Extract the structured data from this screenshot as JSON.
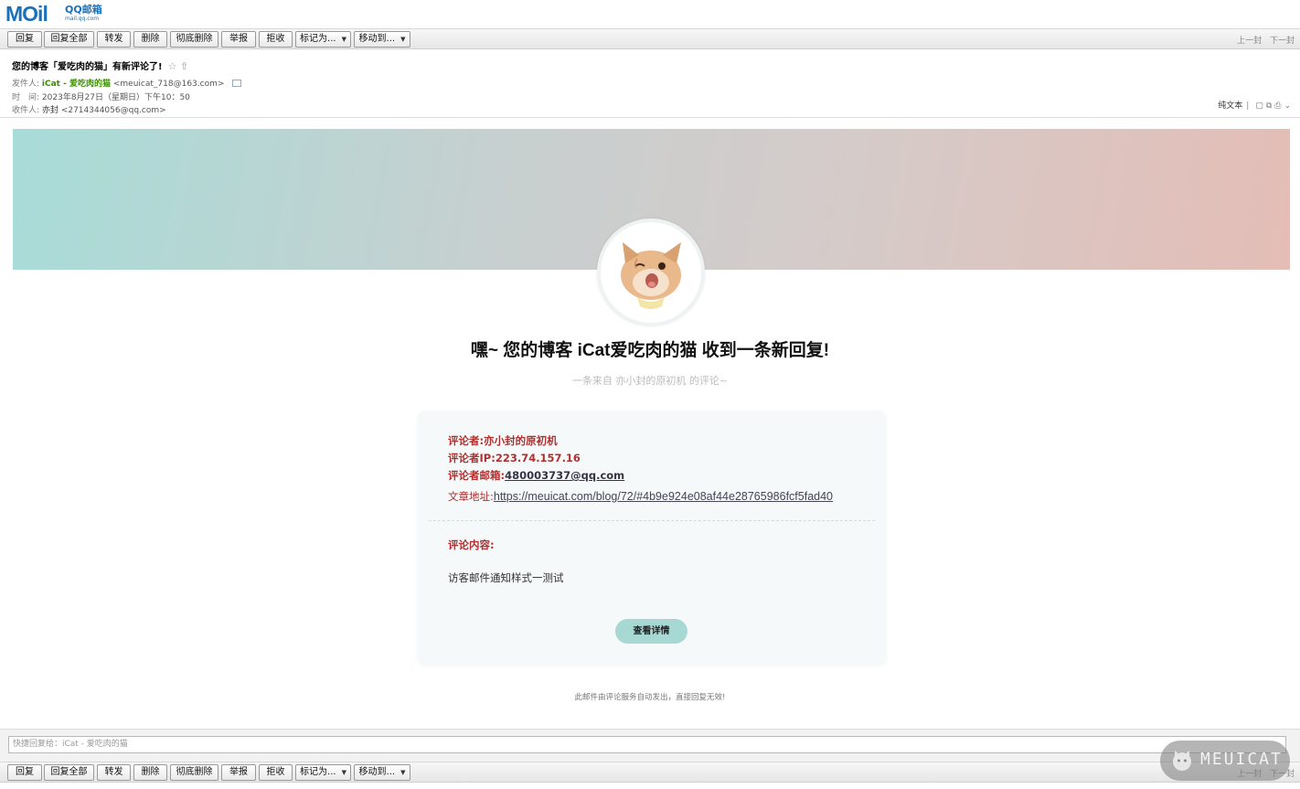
{
  "logo": {
    "mail_text": "MOil",
    "qq_text": "QQ邮箱",
    "domain_text": "mail.qq.com"
  },
  "toolbar": {
    "buttons": [
      "回复",
      "回复全部",
      "转发",
      "删除",
      "彻底删除",
      "举报",
      "拒收",
      "标记为...",
      "移动到..."
    ],
    "prev": "上一封",
    "next": "下一封"
  },
  "header": {
    "subject": "您的博客「爱吃肉的猫」有新评论了!",
    "stars": "☆ ⇧",
    "from_label": "发件人:",
    "from_name": "iCat - 爱吃肉的猫",
    "from_addr": "<meuicat_718@163.com>",
    "time_label": "时　间:",
    "time_value": "2023年8月27日（星期日）下午10：50",
    "to_label": "收件人:",
    "to_name": "亦封",
    "to_addr": "<2714344056@qq.com>",
    "plain_text": "纯文本",
    "sep": "|"
  },
  "mail": {
    "headline": "嘿~ 您的博客 iCat爱吃肉的猫 收到一条新回复!",
    "subline": "一条来自 亦小封的原初机 的评论~",
    "commenter_label": "评论者:",
    "commenter": "亦小封的原初机",
    "ip_label": "评论者IP:",
    "ip": "223.74.157.16",
    "email_label": "评论者邮箱:",
    "email": "480003737@qq.com",
    "url_label": "文章地址:",
    "url": "https://meuicat.com/blog/72/#4b9e924e08af44e28765986fcf5fad40",
    "comment_label": "评论内容:",
    "comment": "访客邮件通知样式一测试",
    "detail_button": "查看详情",
    "footnote": "此邮件由评论服务自动发出，直接回复无效!"
  },
  "quick_reply": {
    "placeholder": "快捷回复给：iCat - 爱吃肉的猫"
  },
  "watermark": {
    "text": "MEUICAT"
  },
  "colors": {
    "accent": "#b03030",
    "button": "#a7d8d4",
    "banner_left": "#a8dcd8",
    "banner_right": "#e4bdb6"
  }
}
